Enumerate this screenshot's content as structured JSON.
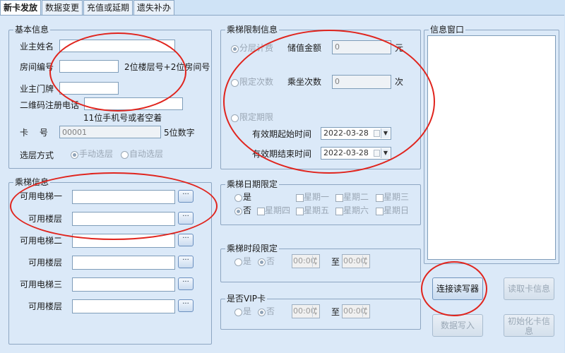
{
  "tabs": [
    "新卡发放",
    "数据变更",
    "充值或延期",
    "遗失补办"
  ],
  "basic": {
    "title": "基本信息",
    "owner_name_label": "业主姓名",
    "room_label": "房间编号",
    "room_hint": "2位楼层号+2位房间号",
    "door_label": "业主门牌",
    "qr_phone_label": "二维码注册电话",
    "qr_phone_hint": "11位手机号或者空着",
    "card_label": "卡　 号",
    "card_value": "00001",
    "card_hint": "5位数字",
    "floor_mode_label": "选层方式",
    "floor_manual": "手动选层",
    "floor_auto": "自动选层"
  },
  "elevator": {
    "title": "乘梯信息",
    "rows": [
      {
        "label": "可用电梯一"
      },
      {
        "label": "可用楼层"
      },
      {
        "label": "可用电梯二"
      },
      {
        "label": "可用楼层"
      },
      {
        "label": "可用电梯三"
      },
      {
        "label": "可用楼层"
      }
    ],
    "dots": "···"
  },
  "limit": {
    "title": "乘梯限制信息",
    "opt_tiered": "分层计费",
    "stored_label": "储值金额",
    "stored_value": "0",
    "stored_unit": "元",
    "opt_times": "限定次数",
    "rides_label": "乘坐次数",
    "rides_value": "0",
    "rides_unit": "次",
    "opt_period": "限定期限",
    "start_label": "有效期起始时间",
    "start_value": "2022-03-28",
    "end_label": "有效期结束时间",
    "end_value": "2022-03-28"
  },
  "date_limit": {
    "title": "乘梯日期限定",
    "yes": "是",
    "no": "否",
    "days": [
      "星期一",
      "星期二",
      "星期三",
      "星期四",
      "星期五",
      "星期六",
      "星期日"
    ]
  },
  "time_limit": {
    "title": "乘梯时段限定",
    "yes": "是",
    "no": "否",
    "from": "00:00",
    "to_label": "至",
    "to": "00:00"
  },
  "vip": {
    "title": "是否VIP卡",
    "yes": "是",
    "no": "否",
    "from": "00:00",
    "to_label": "至",
    "to": "00:00"
  },
  "info": {
    "title": "信息窗口"
  },
  "buttons": {
    "connect": "连接读写器",
    "read": "读取卡信息",
    "write": "数据写入",
    "init_line1": "初始化卡信",
    "init_line2": "息"
  },
  "colors": {
    "background": "#dbe9f8",
    "annotation": "#e0241d"
  }
}
